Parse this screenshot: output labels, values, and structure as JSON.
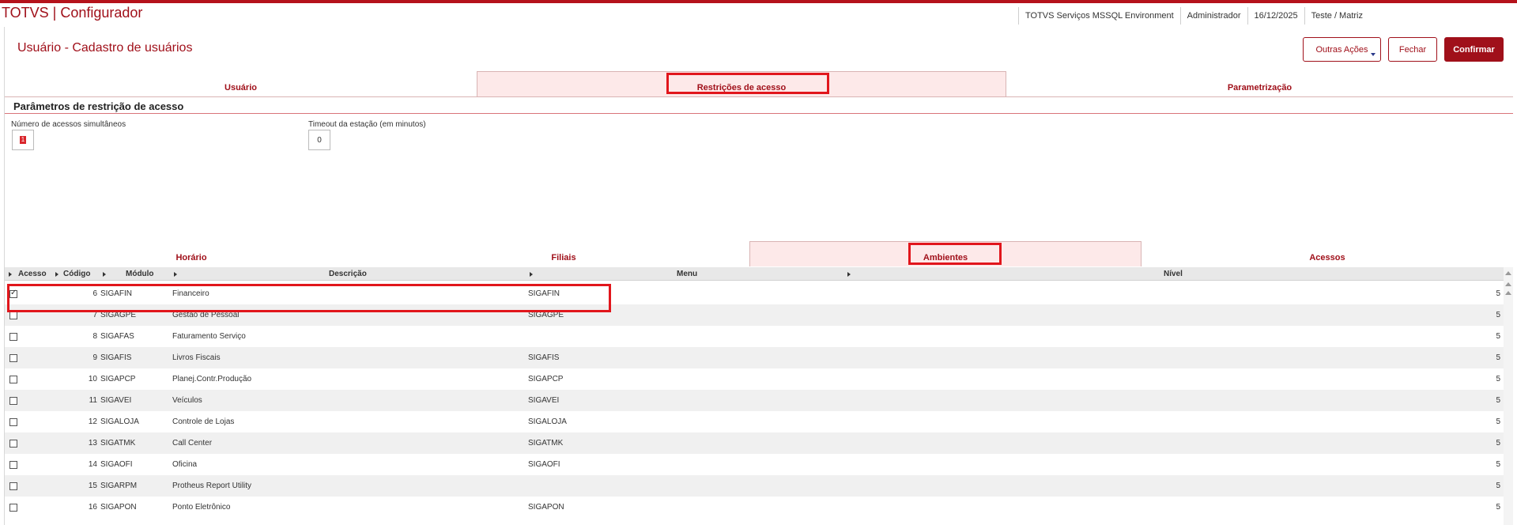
{
  "app": {
    "title": "TOTVS | Configurador"
  },
  "header": {
    "environment": "TOTVS Serviços MSSQL Environment",
    "user": "Administrador",
    "date": "16/12/2025",
    "branch": "Teste / Matriz"
  },
  "page": {
    "title": "Usuário - Cadastro de usuários"
  },
  "buttons": {
    "outras": "Outras Ações",
    "fechar": "Fechar",
    "confirmar": "Confirmar"
  },
  "tabs_top": [
    {
      "label": "Usuário",
      "active": false
    },
    {
      "label": "Restrições de acesso",
      "active": true
    },
    {
      "label": "Parametrização",
      "active": false
    }
  ],
  "section": {
    "title": "Parâmetros de restrição de acesso",
    "fields": [
      {
        "label": "Número de acessos simultâneos",
        "value": "1"
      },
      {
        "label": "Timeout da estação (em minutos)",
        "value": "0"
      }
    ]
  },
  "tabs_bottom": [
    {
      "label": "Horário",
      "active": false
    },
    {
      "label": "Filiais",
      "active": false
    },
    {
      "label": "Ambientes",
      "active": true
    },
    {
      "label": "Acessos",
      "active": false
    }
  ],
  "grid": {
    "columns": [
      "Acesso",
      "Código",
      "Módulo",
      "Descrição",
      "Menu",
      "Nível"
    ],
    "rows": [
      {
        "checked": true,
        "codigo": "6",
        "modulo": "SIGAFIN",
        "descricao": "Financeiro",
        "menu": "SIGAFIN",
        "nivel": "5"
      },
      {
        "checked": false,
        "codigo": "7",
        "modulo": "SIGAGPE",
        "descricao": "Gestão de Pessoal",
        "menu": "SIGAGPE",
        "nivel": "5"
      },
      {
        "checked": false,
        "codigo": "8",
        "modulo": "SIGAFAS",
        "descricao": "Faturamento Serviço",
        "menu": "",
        "nivel": "5"
      },
      {
        "checked": false,
        "codigo": "9",
        "modulo": "SIGAFIS",
        "descricao": "Livros Fiscais",
        "menu": "SIGAFIS",
        "nivel": "5"
      },
      {
        "checked": false,
        "codigo": "10",
        "modulo": "SIGAPCP",
        "descricao": "Planej.Contr.Produção",
        "menu": "SIGAPCP",
        "nivel": "5"
      },
      {
        "checked": false,
        "codigo": "11",
        "modulo": "SIGAVEI",
        "descricao": "Veículos",
        "menu": "SIGAVEI",
        "nivel": "5"
      },
      {
        "checked": false,
        "codigo": "12",
        "modulo": "SIGALOJA",
        "descricao": "Controle de Lojas",
        "menu": "SIGALOJA",
        "nivel": "5"
      },
      {
        "checked": false,
        "codigo": "13",
        "modulo": "SIGATMK",
        "descricao": "Call Center",
        "menu": "SIGATMK",
        "nivel": "5"
      },
      {
        "checked": false,
        "codigo": "14",
        "modulo": "SIGAOFI",
        "descricao": "Oficina",
        "menu": "SIGAOFI",
        "nivel": "5"
      },
      {
        "checked": false,
        "codigo": "15",
        "modulo": "SIGARPM",
        "descricao": "Protheus Report Utility",
        "menu": "",
        "nivel": "5"
      },
      {
        "checked": false,
        "codigo": "16",
        "modulo": "SIGAPON",
        "descricao": "Ponto Eletrônico",
        "menu": "SIGAPON",
        "nivel": "5"
      }
    ]
  },
  "colors": {
    "brand": "#a0101a",
    "highlight": "#e1161c",
    "active_tab_bg": "#fde9e9"
  }
}
